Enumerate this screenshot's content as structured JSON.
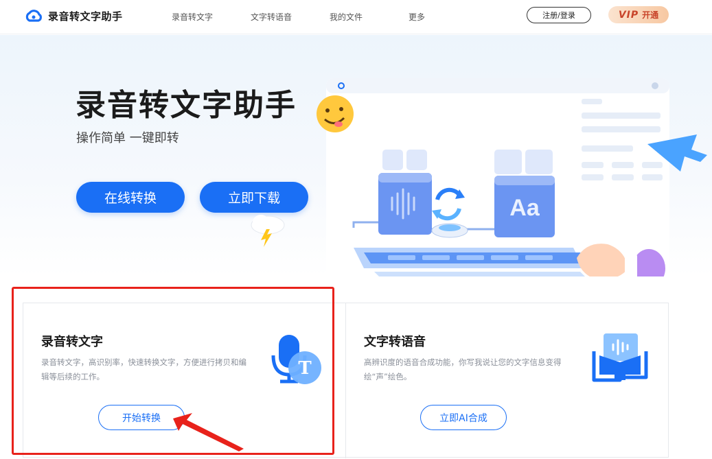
{
  "header": {
    "logo_text": "录音转文字助手",
    "nav": [
      "录音转文字",
      "文字转语音",
      "我的文件",
      "更多"
    ],
    "login_label": "注册/登录",
    "vip_mark": "VIP",
    "vip_label": "开通"
  },
  "hero": {
    "title": "录音转文字助手",
    "subtitle": "操作简单 一键即转",
    "btn_online": "在线转换",
    "btn_download": "立即下载",
    "illustration_text": "Aa"
  },
  "cards": [
    {
      "title": "录音转文字",
      "desc": "录音转文字，高识别率，快速转换文字，方便进行拷贝和编辑等后续的工作。",
      "button": "开始转换",
      "icon": "microphone-text-icon",
      "icon_letter": "T"
    },
    {
      "title": "文字转语音",
      "desc": "高辨识度的语音合成功能，你写我说让您的文字信息变得绘“声”绘色。",
      "button": "立即AI合成",
      "icon": "voice-book-icon"
    }
  ],
  "colors": {
    "primary": "#1a6ff5",
    "highlight": "#e8221b",
    "vip_text": "#c8442a"
  }
}
